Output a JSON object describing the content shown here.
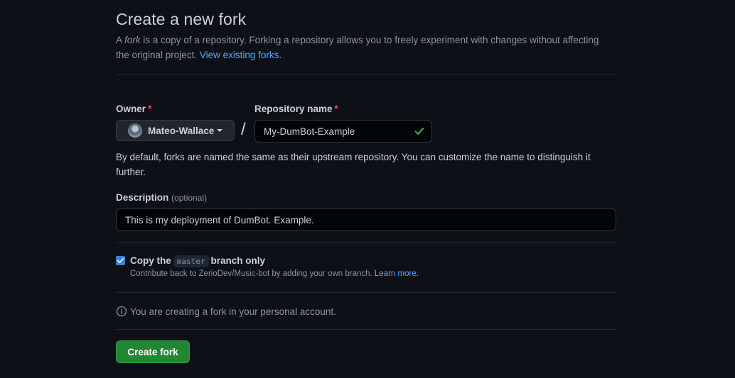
{
  "header": {
    "title": "Create a new fork",
    "intro_prefix": "A ",
    "intro_em": "fork",
    "intro_text": " is a copy of a repository. Forking a repository allows you to freely experiment with changes without affecting the original project. ",
    "intro_link": "View existing forks."
  },
  "form": {
    "owner_label": "Owner",
    "required_mark": "*",
    "owner_value": "Mateo-Wallace",
    "slash": "/",
    "repo_label": "Repository name",
    "repo_value": "My-DumBot-Example",
    "name_hint": "By default, forks are named the same as their upstream repository. You can customize the name to distinguish it further.",
    "description_label": "Description",
    "description_optional": "(optional)",
    "description_value": "This is my deployment of DumBot. Example.",
    "copy_prefix": "Copy the",
    "copy_branch": "master",
    "copy_suffix": "branch only",
    "copy_checked": true,
    "copy_note": "Contribute back to ZerioDev/Music-bot by adding your own branch. ",
    "copy_note_link": "Learn more.",
    "info_text": "You are creating a fork in your personal account.",
    "create_button": "Create fork"
  },
  "colors": {
    "background": "#0d1117",
    "link": "#58a6ff",
    "primary_button": "#238636",
    "required": "#f85149",
    "valid_check": "#3fb950",
    "checkbox": "#3a84d6"
  },
  "icons": {
    "valid": "check-icon",
    "info": "info-icon",
    "caret": "caret-down-icon",
    "checkbox": "checkbox-checked-icon"
  }
}
